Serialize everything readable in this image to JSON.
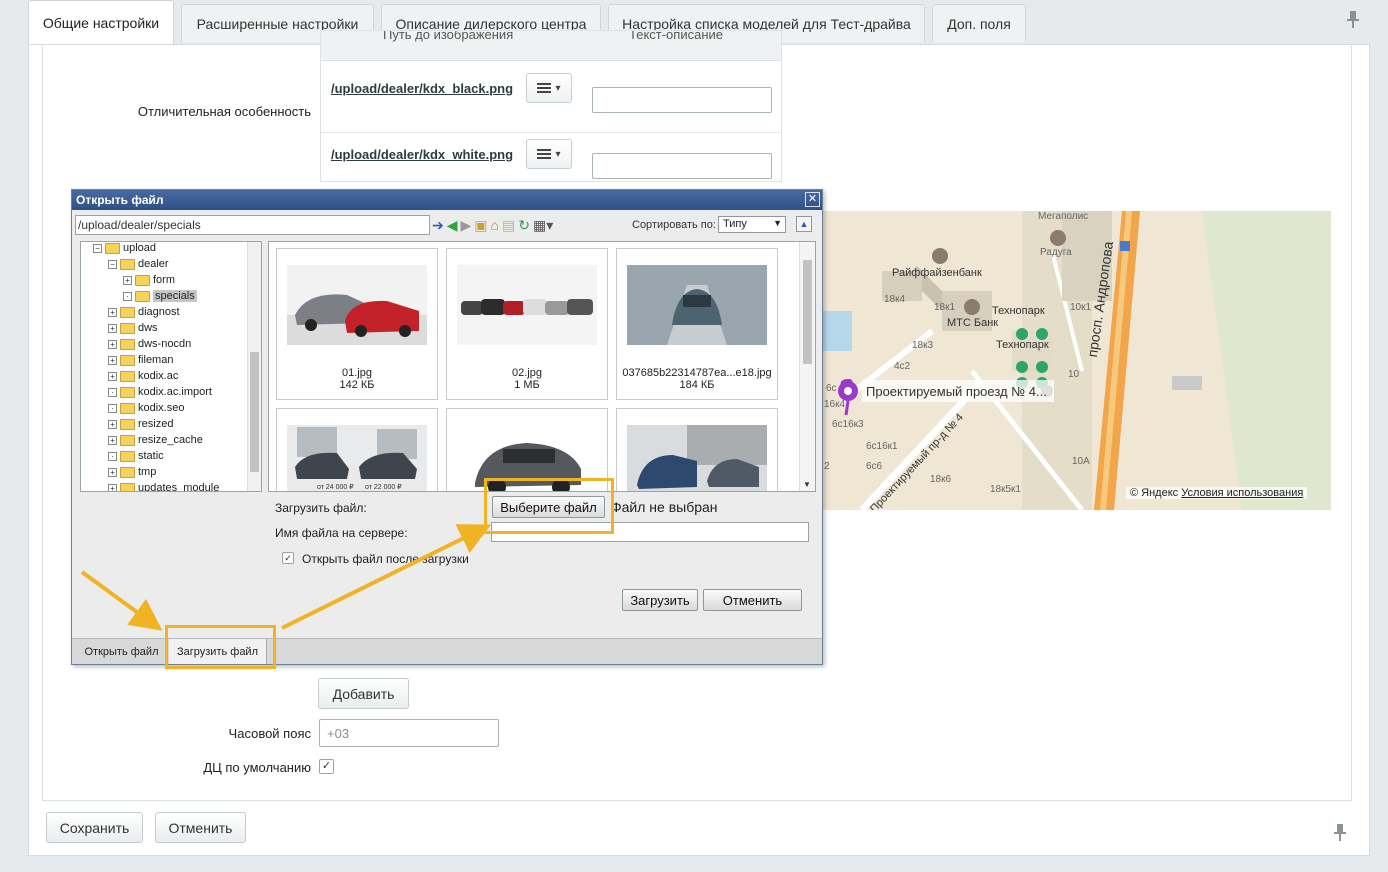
{
  "tabs": [
    {
      "label": "Общие настройки",
      "active": true
    },
    {
      "label": "Расширенные настройки",
      "active": false
    },
    {
      "label": "Описание дилерского центра",
      "active": false
    },
    {
      "label": "Настройка списка моделей для Тест-драйва",
      "active": false
    },
    {
      "label": "Доп. поля",
      "active": false
    }
  ],
  "form": {
    "image_table": {
      "col_path": "Путь до изображения",
      "col_desc": "Текст-описание",
      "rows": [
        {
          "path": "/upload/dealer/kdx_black.png",
          "desc": ""
        },
        {
          "path": "/upload/dealer/kdx_white.png",
          "desc": ""
        }
      ]
    },
    "feature_label": "Отличительная особенность",
    "add_button": "Добавить",
    "timezone_label": "Часовой пояс",
    "timezone_placeholder": "+03",
    "default_dc_label": "ДЦ по умолчанию",
    "default_dc_checked": true,
    "save_button": "Сохранить",
    "cancel_button": "Отменить"
  },
  "map": {
    "labels": [
      "Мегаполис",
      "Радуга",
      "Райффайзенбанк",
      "18к4",
      "18к1",
      "МТС Банк",
      "Технопарк",
      "Технопарк",
      "10к1",
      "просп. Андропова",
      "18к3",
      "4с2",
      "10",
      "Проектируемый проезд № 4...",
      "6с",
      "16к4",
      "6с16к3",
      "6с16к1",
      "6с6",
      "Проектируемый пр-д № 4",
      "18к6",
      "18к5к1",
      "10А",
      "2"
    ],
    "copyright": "© Яндекс",
    "terms_link": "Условия использования"
  },
  "dialog": {
    "title": "Открыть файл",
    "path": "/upload/dealer/specials",
    "sort_label": "Сортировать по:",
    "sort_value": "Типу",
    "tree": [
      {
        "name": "upload",
        "depth": 0,
        "toggle": "−"
      },
      {
        "name": "dealer",
        "depth": 1,
        "toggle": "−"
      },
      {
        "name": "form",
        "depth": 2,
        "toggle": "+"
      },
      {
        "name": "specials",
        "depth": 2,
        "toggle": "·",
        "selected": true
      },
      {
        "name": "diagnost",
        "depth": 1,
        "toggle": "+"
      },
      {
        "name": "dws",
        "depth": 1,
        "toggle": "+"
      },
      {
        "name": "dws-nocdn",
        "depth": 1,
        "toggle": "+"
      },
      {
        "name": "fileman",
        "depth": 1,
        "toggle": "+"
      },
      {
        "name": "kodix.ac",
        "depth": 1,
        "toggle": "+"
      },
      {
        "name": "kodix.ac.import",
        "depth": 1,
        "toggle": "·"
      },
      {
        "name": "kodix.seo",
        "depth": 1,
        "toggle": "·"
      },
      {
        "name": "resized",
        "depth": 1,
        "toggle": "+"
      },
      {
        "name": "resize_cache",
        "depth": 1,
        "toggle": "+"
      },
      {
        "name": "static",
        "depth": 1,
        "toggle": "·"
      },
      {
        "name": "tmp",
        "depth": 1,
        "toggle": "+"
      },
      {
        "name": "updates_module",
        "depth": 1,
        "toggle": "+"
      }
    ],
    "files": [
      {
        "name": "01.jpg",
        "size": "142 КБ"
      },
      {
        "name": "02.jpg",
        "size": "1 МБ"
      },
      {
        "name": "037685b22314787ea...e18.jpg",
        "size": "184 КБ"
      },
      {
        "name": "",
        "size": ""
      },
      {
        "name": "",
        "size": ""
      },
      {
        "name": "",
        "size": ""
      }
    ],
    "thumb4_price1": "от 24 000 ₽",
    "thumb4_price2": "от 22 000 ₽",
    "upload_label": "Загрузить файл:",
    "choose_button": "Выберите файл",
    "no_file": "Файл не выбран",
    "server_name_label": "Имя файла на сервере:",
    "open_after_label": "Открыть файл после загрузки",
    "open_after_checked": true,
    "upload_button": "Загрузить",
    "cancel_button": "Отменить",
    "bottom_tabs": [
      {
        "label": "Открыть файл",
        "active": false
      },
      {
        "label": "Загрузить файл",
        "active": true
      }
    ]
  },
  "colors": {
    "highlight": "#f0b323",
    "dialog_title": "#2f4f86",
    "map_bg": "#efe6d3",
    "road": "#f2a54b"
  }
}
